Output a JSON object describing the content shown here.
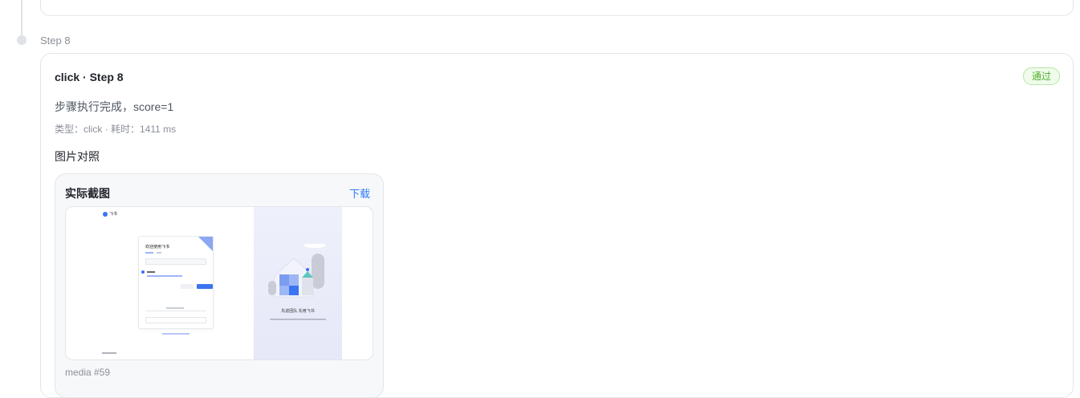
{
  "step": {
    "label": "Step 8",
    "card_title": "click · Step 8",
    "status_badge": "通过",
    "summary": "步骤执行完成，score=1",
    "meta": "类型：click · 耗时：1411 ms",
    "section_title": "图片对照",
    "media": {
      "title": "实际截图",
      "download_label": "下载",
      "caption": "media #59",
      "thumbnail": {
        "logo_text": "飞书",
        "login_title": "欢迎使用飞书",
        "illustration_caption": "先进团队 先用飞书"
      }
    }
  },
  "colors": {
    "accent": "#2e7cf6",
    "success": "#4caf2a",
    "border": "#e3e6ea"
  }
}
